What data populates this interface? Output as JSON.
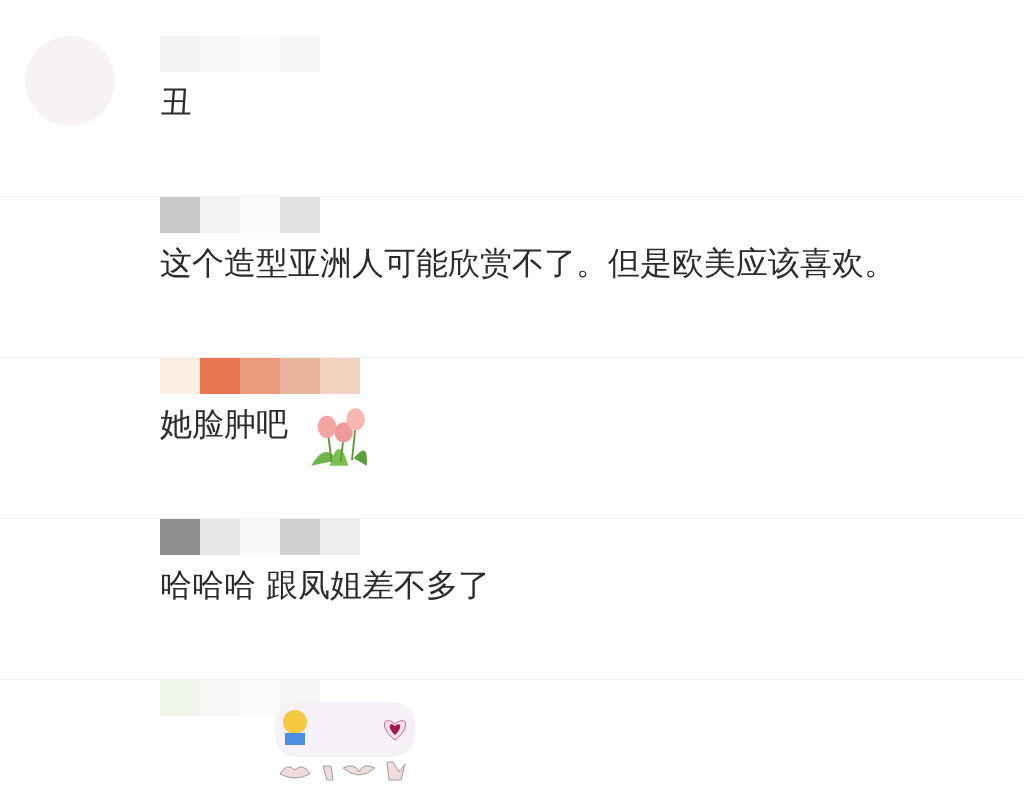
{
  "comments": [
    {
      "kind": "text",
      "avatar": true,
      "text": "丑"
    },
    {
      "kind": "text",
      "avatar": false,
      "text": "这个造型亚洲人可能欣赏不了。但是欧美应该喜欢。"
    },
    {
      "kind": "text-sticker",
      "avatar": false,
      "text": "她脸肿吧"
    },
    {
      "kind": "text",
      "avatar": false,
      "text": "哈哈哈 跟凤姐差不多了"
    },
    {
      "kind": "sticker",
      "avatar": false
    }
  ]
}
